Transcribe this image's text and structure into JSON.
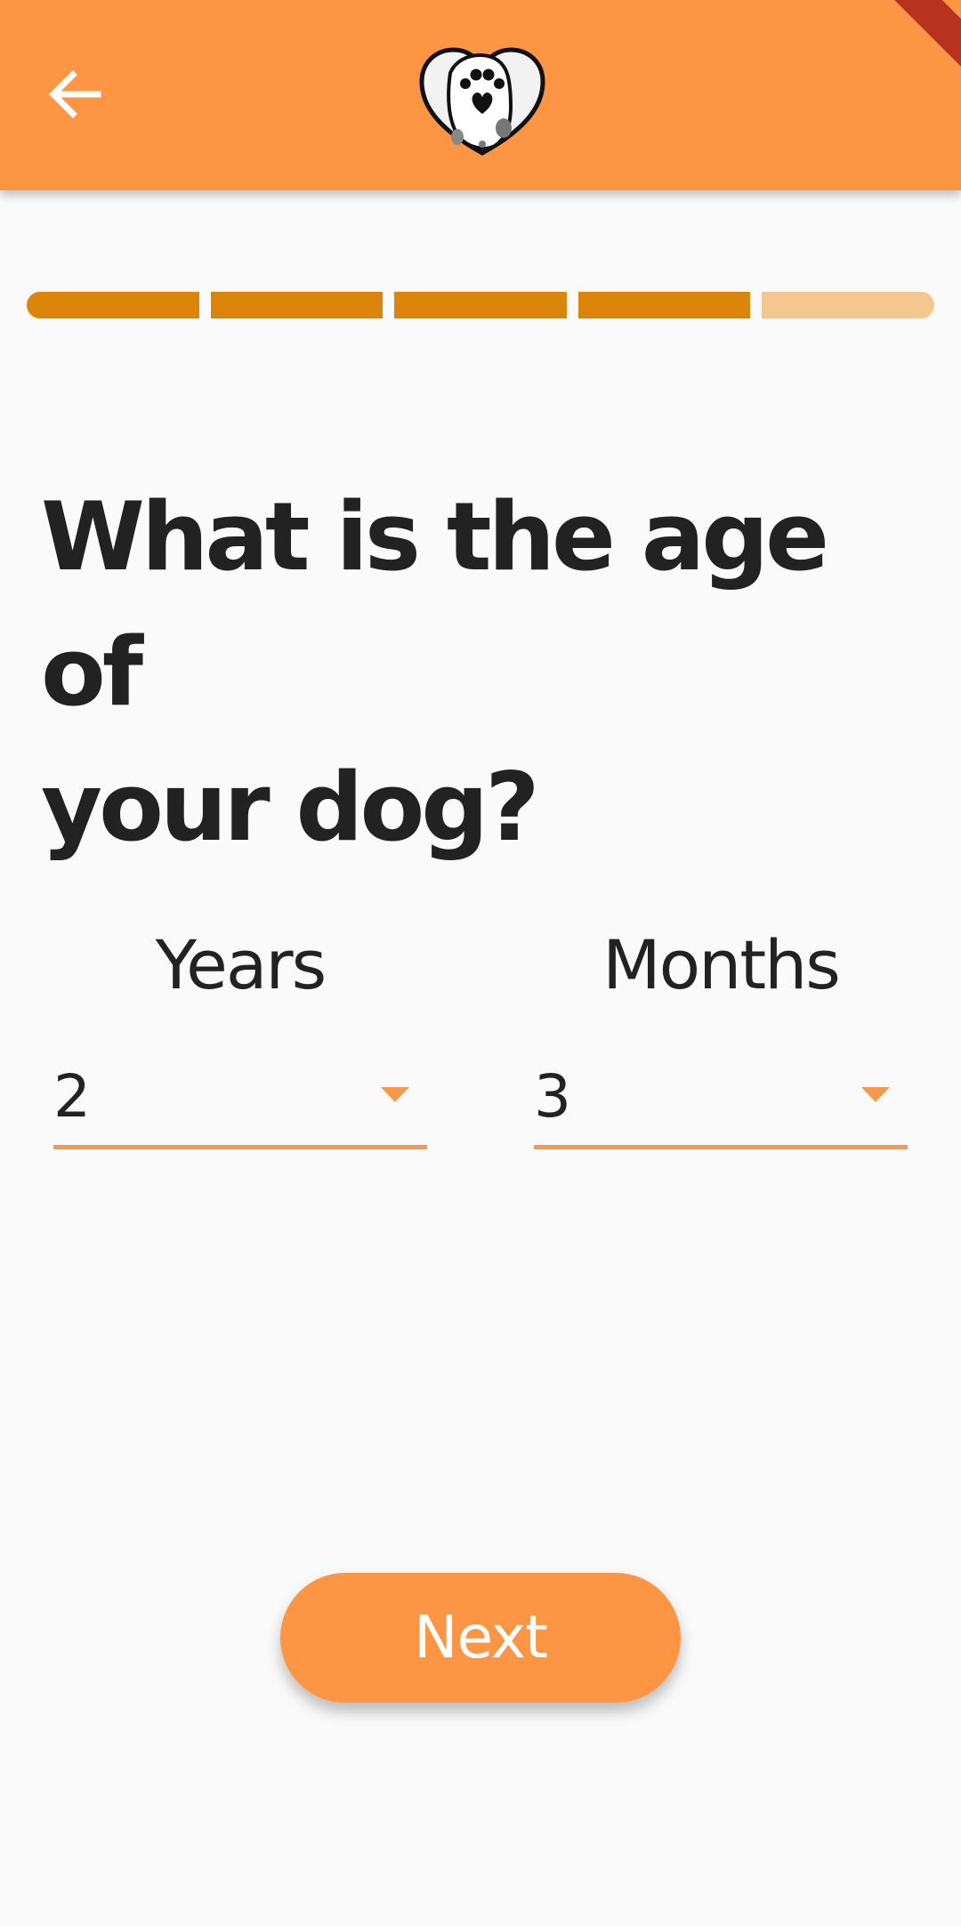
{
  "app_bar": {
    "back_icon": "arrow-left-icon",
    "logo": "dog-paw-heart-logo",
    "background_color": "#fd9644"
  },
  "progress": {
    "total_steps": 5,
    "current_step": 4,
    "active_color": "#dc850b",
    "inactive_color": "#f3c78e"
  },
  "question": {
    "line1": "What is the age of",
    "line2": "your dog?"
  },
  "years": {
    "label": "Years",
    "value": "2",
    "icon": "caret-down-icon"
  },
  "months": {
    "label": "Months",
    "value": "3",
    "icon": "caret-down-icon"
  },
  "next_button": {
    "label": "Next",
    "color": "#fd9644"
  }
}
